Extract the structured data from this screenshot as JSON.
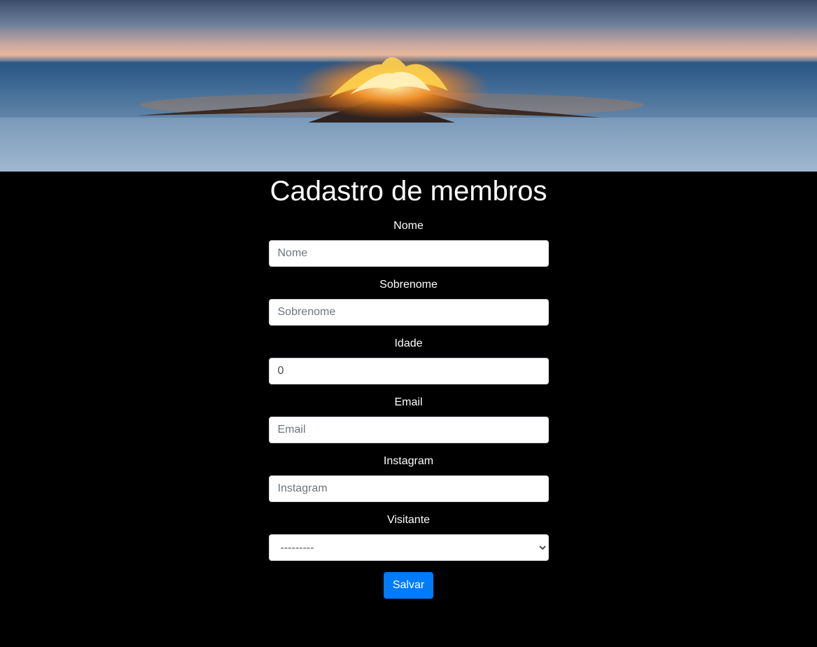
{
  "page": {
    "title": "Cadastro de membros"
  },
  "form": {
    "nome": {
      "label": "Nome",
      "placeholder": "Nome",
      "value": ""
    },
    "sobrenome": {
      "label": "Sobrenome",
      "placeholder": "Sobrenome",
      "value": ""
    },
    "idade": {
      "label": "Idade",
      "placeholder": "",
      "value": "0"
    },
    "email": {
      "label": "Email",
      "placeholder": "Email",
      "value": ""
    },
    "instagram": {
      "label": "Instagram",
      "placeholder": "Instagram",
      "value": ""
    },
    "visitante": {
      "label": "Visitante",
      "selected": "---------"
    },
    "submit_label": "Salvar"
  },
  "colors": {
    "background": "#000000",
    "button": "#007bff"
  }
}
